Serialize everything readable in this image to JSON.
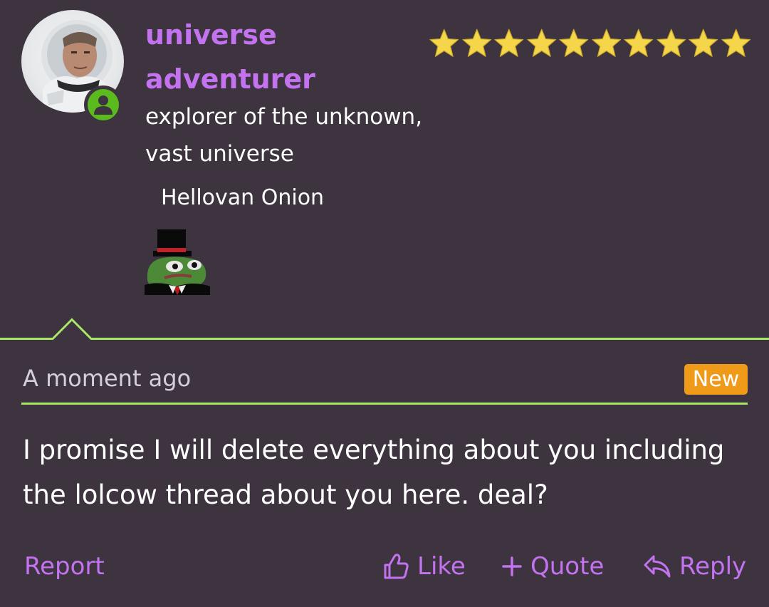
{
  "user": {
    "name": "universe adventurer",
    "title": "explorer of the unknown, vast universe",
    "banner": "Hellovan Onion",
    "status": "online",
    "rating_stars": 10,
    "avatar": "astronaut-avatar",
    "art": "pepe-top-hat-icon"
  },
  "post": {
    "timestamp": "A moment ago",
    "badge": "New",
    "body": "I promise I will delete everything about you including the lolcow thread about you here. deal?"
  },
  "actions": {
    "report": "Report",
    "like": "Like",
    "quote": "Quote",
    "reply": "Reply"
  },
  "colors": {
    "background": "#3e3440",
    "accent": "#c372f0",
    "divider": "#a7e866",
    "badge": "#f09a1a",
    "online": "#5bba1e",
    "star": "#f5d54a"
  }
}
